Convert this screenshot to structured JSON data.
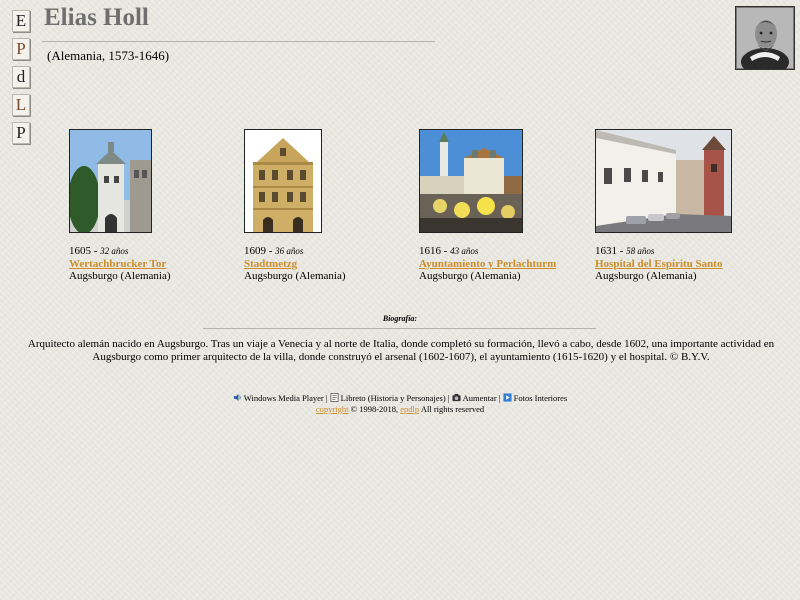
{
  "nav": {
    "items": [
      {
        "letter": "E"
      },
      {
        "letter": "P"
      },
      {
        "letter": "d"
      },
      {
        "letter": "L"
      },
      {
        "letter": "P"
      }
    ]
  },
  "header": {
    "title": "Elias Holl",
    "subtitle": "(Alemania, 1573-1646)"
  },
  "works": [
    {
      "year": "1605",
      "age": "32 años",
      "name": "Wertachbrucker Tor",
      "place": "Augsburgo (Alemania)"
    },
    {
      "year": "1609",
      "age": "36 años",
      "name": "Stadtmetzg",
      "place": "Augsburgo (Alemania)"
    },
    {
      "year": "1616",
      "age": "43 años",
      "name": "Ayuntamiento y Perlachturm",
      "place": "Augsburgo (Alemania)"
    },
    {
      "year": "1631",
      "age": "58 años",
      "name": "Hospital del Espíritu Santo",
      "place": "Augsburgo (Alemania)"
    }
  ],
  "bio": {
    "heading": "Biografía:",
    "text": "Arquitecto alemán nacido en Augsburgo. Tras un viaje a Venecia y al norte de Italia, donde completó su formación, llevó a cabo, desde 1602, una importante actividad en Augsburgo como primer arquitecto de la villa, donde construyó el arsenal (1602-1607), el ayuntamiento (1615-1620) y el hospital.  © B.Y.V."
  },
  "footer": {
    "links": [
      {
        "label": "Windows Media Player",
        "icon": "speaker-icon"
      },
      {
        "label": "Libreto (Historia y Personajes)",
        "icon": "document-icon"
      },
      {
        "label": "Aumentar",
        "icon": "camera-icon"
      },
      {
        "label": "Fotos Interiores",
        "icon": "photo-icon"
      }
    ],
    "separator": "|",
    "copyright_link": "copyright",
    "years": "© 1998-2018,",
    "site_link": "epdlp",
    "rights": "All rights reserved"
  }
}
